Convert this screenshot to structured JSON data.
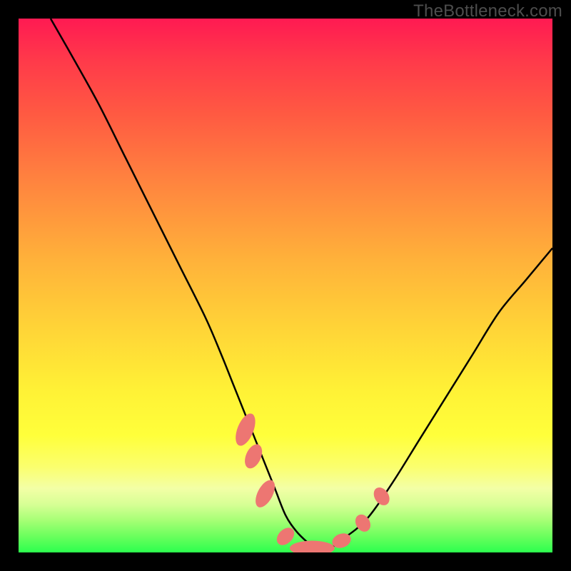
{
  "watermark": "TheBottleneck.com",
  "chart_data": {
    "type": "line",
    "title": "",
    "xlabel": "",
    "ylabel": "",
    "xlim": [
      0,
      100
    ],
    "ylim": [
      0,
      100
    ],
    "grid": false,
    "series": [
      {
        "name": "bottleneck-curve",
        "x": [
          6,
          10,
          15,
          20,
          25,
          30,
          35,
          38,
          40,
          42,
          44,
          46,
          48,
          50,
          52,
          54,
          56,
          58,
          60,
          65,
          70,
          75,
          80,
          85,
          90,
          95,
          100
        ],
        "y": [
          100,
          93,
          84,
          74,
          64,
          54,
          44,
          37,
          32,
          27,
          22,
          17,
          12,
          7,
          4,
          2,
          0.5,
          0.5,
          2,
          6,
          13,
          21,
          29,
          37,
          45,
          51,
          57
        ]
      }
    ],
    "markers": [
      {
        "cx": 42.5,
        "cy": 23,
        "rx": 1.5,
        "ry": 3.2,
        "rot": 22
      },
      {
        "cx": 44.0,
        "cy": 18,
        "rx": 1.4,
        "ry": 2.4,
        "rot": 24
      },
      {
        "cx": 46.2,
        "cy": 11,
        "rx": 1.4,
        "ry": 2.8,
        "rot": 28
      },
      {
        "cx": 50.0,
        "cy": 3.0,
        "rx": 1.3,
        "ry": 1.9,
        "rot": 45
      },
      {
        "cx": 55.0,
        "cy": 0.8,
        "rx": 4.2,
        "ry": 1.4,
        "rot": 0
      },
      {
        "cx": 60.5,
        "cy": 2.2,
        "rx": 1.8,
        "ry": 1.3,
        "rot": -20
      },
      {
        "cx": 64.5,
        "cy": 5.5,
        "rx": 1.3,
        "ry": 1.7,
        "rot": -30
      },
      {
        "cx": 68.0,
        "cy": 10.5,
        "rx": 1.3,
        "ry": 1.8,
        "rot": -33
      }
    ],
    "marker_color": "#ed7672",
    "curve_color": "#000000"
  }
}
